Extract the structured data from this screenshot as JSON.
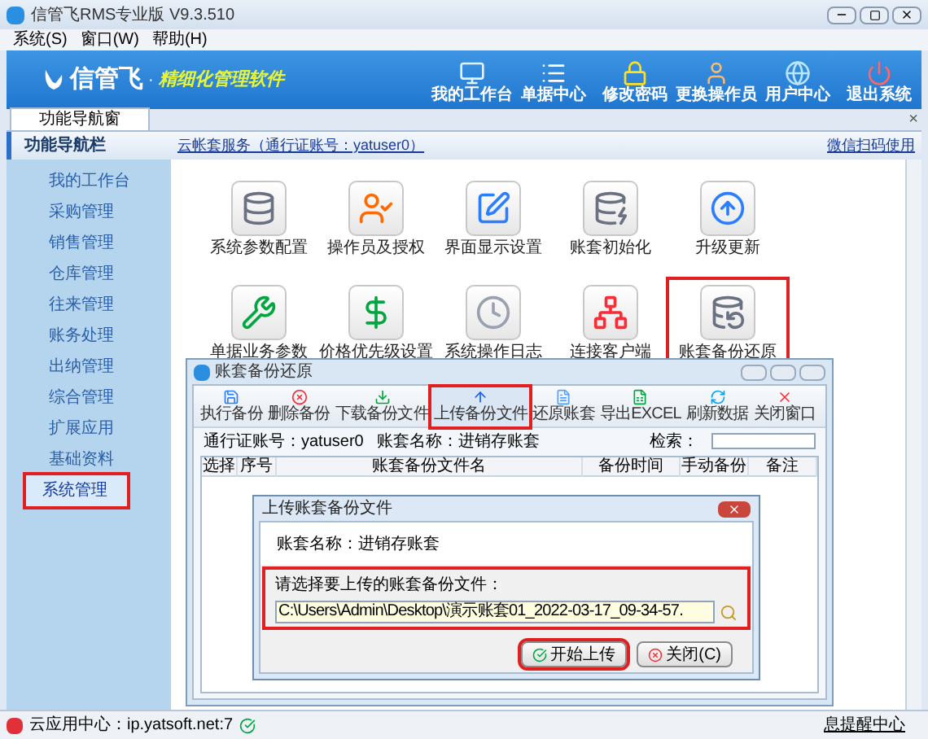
{
  "window": {
    "title": "信管飞RMS专业版 V9.3.510"
  },
  "menu": [
    {
      "label": "系统(S)"
    },
    {
      "label": "窗口(W)"
    },
    {
      "label": "帮助(H)"
    }
  ],
  "banner": {
    "brand": "信管飞",
    "separator": "·",
    "slogan": "精细化管理软件",
    "buttons": [
      {
        "label": "我的工作台",
        "kind": "monitor"
      },
      {
        "label": "单据中心",
        "kind": "list"
      },
      {
        "label": "修改密码",
        "kind": "lock"
      },
      {
        "label": "更换操作员",
        "kind": "user"
      },
      {
        "label": "用户中心",
        "kind": "globe"
      },
      {
        "label": "退出系统",
        "kind": "power"
      }
    ]
  },
  "tabs": [
    {
      "label": "功能导航窗",
      "selected": true
    }
  ],
  "tab_close": "×",
  "nav_header": "功能导航栏",
  "cloud_link": "云帐套服务（通行证账号：yatuser0）",
  "wechat_link": "微信扫码使用",
  "sidebar": {
    "items": [
      {
        "label": "我的工作台",
        "selected": false,
        "highlighted": false
      },
      {
        "label": "采购管理",
        "selected": false,
        "highlighted": false
      },
      {
        "label": "销售管理",
        "selected": false,
        "highlighted": false
      },
      {
        "label": "仓库管理",
        "selected": false,
        "highlighted": false
      },
      {
        "label": "往来管理",
        "selected": false,
        "highlighted": false
      },
      {
        "label": "账务处理",
        "selected": false,
        "highlighted": false
      },
      {
        "label": "出纳管理",
        "selected": false,
        "highlighted": false
      },
      {
        "label": "综合管理",
        "selected": false,
        "highlighted": false
      },
      {
        "label": "扩展应用",
        "selected": false,
        "highlighted": false
      },
      {
        "label": "基础资料",
        "selected": false,
        "highlighted": false
      },
      {
        "label": "系统管理",
        "selected": true,
        "highlighted": true
      }
    ]
  },
  "functions": [
    {
      "label": "系统参数配置",
      "kind": "database-gear",
      "highlighted": false
    },
    {
      "label": "操作员及授权",
      "kind": "user-check",
      "highlighted": false
    },
    {
      "label": "界面显示设置",
      "kind": "pen",
      "highlighted": false
    },
    {
      "label": "账套初始化",
      "kind": "database-arrow",
      "highlighted": false
    },
    {
      "label": "升级更新",
      "kind": "upgrade",
      "highlighted": false
    },
    {
      "label": "单据业务参数",
      "kind": "wrench",
      "highlighted": false
    },
    {
      "label": "价格优先级设置",
      "kind": "dollar",
      "highlighted": false
    },
    {
      "label": "系统操作日志",
      "kind": "clock",
      "highlighted": false
    },
    {
      "label": "连接客户端",
      "kind": "network",
      "highlighted": false
    },
    {
      "label": "账套备份还原",
      "kind": "database-backup",
      "highlighted": true
    }
  ],
  "status_bar": {
    "cloud_center": "云应用中心：ip.yatsoft.net:7",
    "message_center": "息提醒中心"
  },
  "backup_dialog": {
    "title": "账套备份还原",
    "toolbar": [
      {
        "label": "执行备份",
        "kind": "save",
        "highlighted": false
      },
      {
        "label": "删除备份",
        "kind": "delete",
        "highlighted": false
      },
      {
        "label": "下载备份文件",
        "kind": "download",
        "highlighted": false
      },
      {
        "label": "上传备份文件",
        "kind": "upload",
        "highlighted": true
      },
      {
        "label": "还原账套",
        "kind": "restore",
        "highlighted": false
      },
      {
        "label": "导出EXCEL",
        "kind": "excel",
        "highlighted": false
      },
      {
        "label": "刷新数据",
        "kind": "refresh",
        "highlighted": false
      },
      {
        "label": "关闭窗口",
        "kind": "close",
        "highlighted": false
      }
    ],
    "account": "通行证账号：yatuser0",
    "account_set": "账套名称：进销存账套",
    "search_label": "检索：",
    "columns": [
      "选择",
      "序号",
      "账套备份文件名",
      "备份时间",
      "手动备份",
      "备注"
    ]
  },
  "upload_dialog": {
    "title": "上传账套备份文件",
    "account_set": "账套名称：进销存账套",
    "prompt": "请选择要上传的账套备份文件：",
    "file_path": "C:\\Users\\Admin\\Desktop\\演示账套01_2022-03-17_09-34-57.",
    "start_button": {
      "label": "开始上传",
      "highlighted": true
    },
    "close_button": {
      "label": "关闭(C)",
      "highlighted": false
    }
  }
}
